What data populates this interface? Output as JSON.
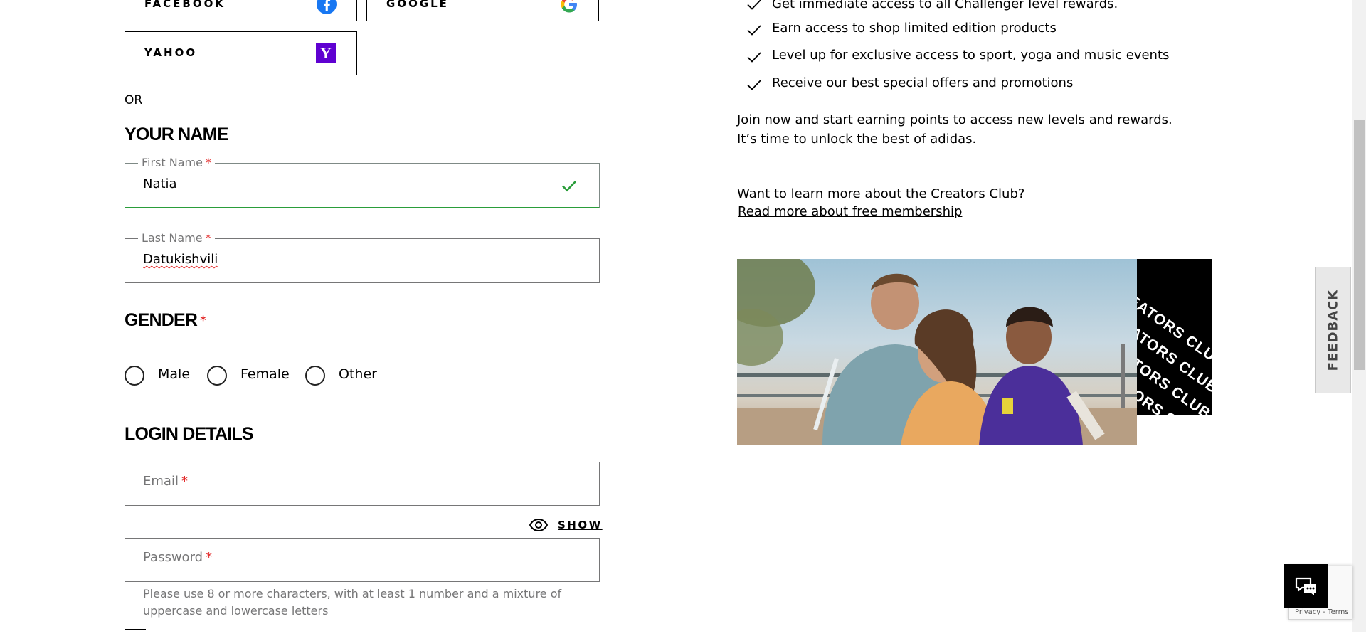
{
  "social": {
    "facebook_label": "FACEBOOK",
    "google_label": "GOOGLE",
    "yahoo_label": "YAHOO",
    "yahoo_icon_letter": "Y",
    "facebook_color": "#1877f2",
    "yahoo_color": "#5f01d1"
  },
  "or_text": "OR",
  "your_name": {
    "title": "YOUR NAME",
    "first_name_label": "First Name",
    "first_name_value": "Natia",
    "last_name_label": "Last Name",
    "last_name_value": "Datukishvili",
    "required_mark": "*"
  },
  "gender": {
    "title": "GENDER",
    "options": [
      "Male",
      "Female",
      "Other"
    ]
  },
  "login": {
    "title": "LOGIN DETAILS",
    "email_placeholder": "Email",
    "show_label": "SHOW",
    "password_placeholder": "Password",
    "password_hint": "Please use 8 or more characters, with at least 1 number and a mixture of uppercase and lowercase letters"
  },
  "benefits": {
    "items": [
      "Get immediate access to all Challenger level rewards.",
      "Earn access to shop limited edition products",
      "Level up for exclusive access to sport, yoga and music events",
      "Receive our best special offers and promotions"
    ],
    "join_text": "Join now and start earning points to access new levels and rewards. It’s time to unlock the best of adidas.",
    "learn_more": "Want to learn more about the Creators Club?",
    "read_more_link": "Read more about free membership"
  },
  "creators_panel_text": "CREATORS CLUB",
  "feedback_label": "FEEDBACK",
  "recaptcha_terms": "Privacy - Terms",
  "colors": {
    "valid_green": "#2a9d3a",
    "required_red": "#e32b2b",
    "muted_gray": "#767677"
  }
}
